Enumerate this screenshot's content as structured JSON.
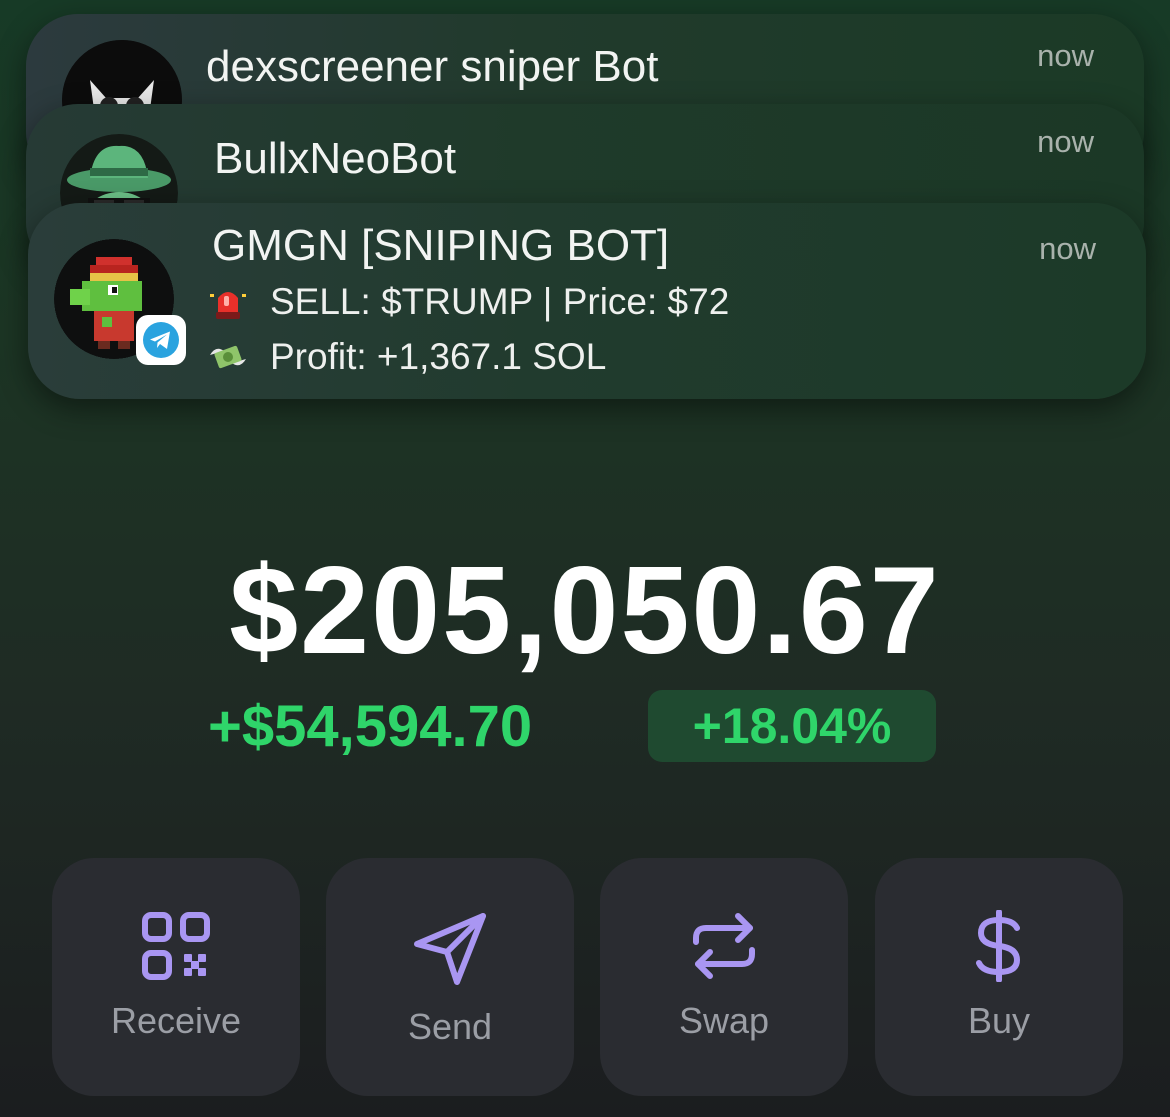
{
  "notifications": [
    {
      "app": "dexscreener sniper Bot",
      "time": "now",
      "avatar_icon": "owl-avatar-icon"
    },
    {
      "app": "BullxNeoBot",
      "time": "now",
      "avatar_icon": "hat-frog-avatar-icon"
    },
    {
      "app": "GMGN [SNIPING BOT]",
      "time": "now",
      "avatar_icon": "pixel-frog-avatar-icon",
      "badge_icon": "telegram-icon",
      "lines": [
        {
          "icon": "siren-icon",
          "text": "SELL: $TRUMP | Price: $72"
        },
        {
          "icon": "money-wings-icon",
          "text": "Profit: +1,367.1 SOL"
        }
      ]
    }
  ],
  "wallet": {
    "balance": "$205,050.67",
    "change": "+$54,594.70",
    "change_pct": "+18.04%"
  },
  "actions": [
    {
      "label": "Receive",
      "icon": "qr-code-icon"
    },
    {
      "label": "Send",
      "icon": "send-icon"
    },
    {
      "label": "Swap",
      "icon": "swap-icon"
    },
    {
      "label": "Buy",
      "icon": "dollar-icon"
    }
  ],
  "colors": {
    "positive": "#2fd56a",
    "accent": "#a996f2",
    "button_bg": "#2a2c31"
  }
}
